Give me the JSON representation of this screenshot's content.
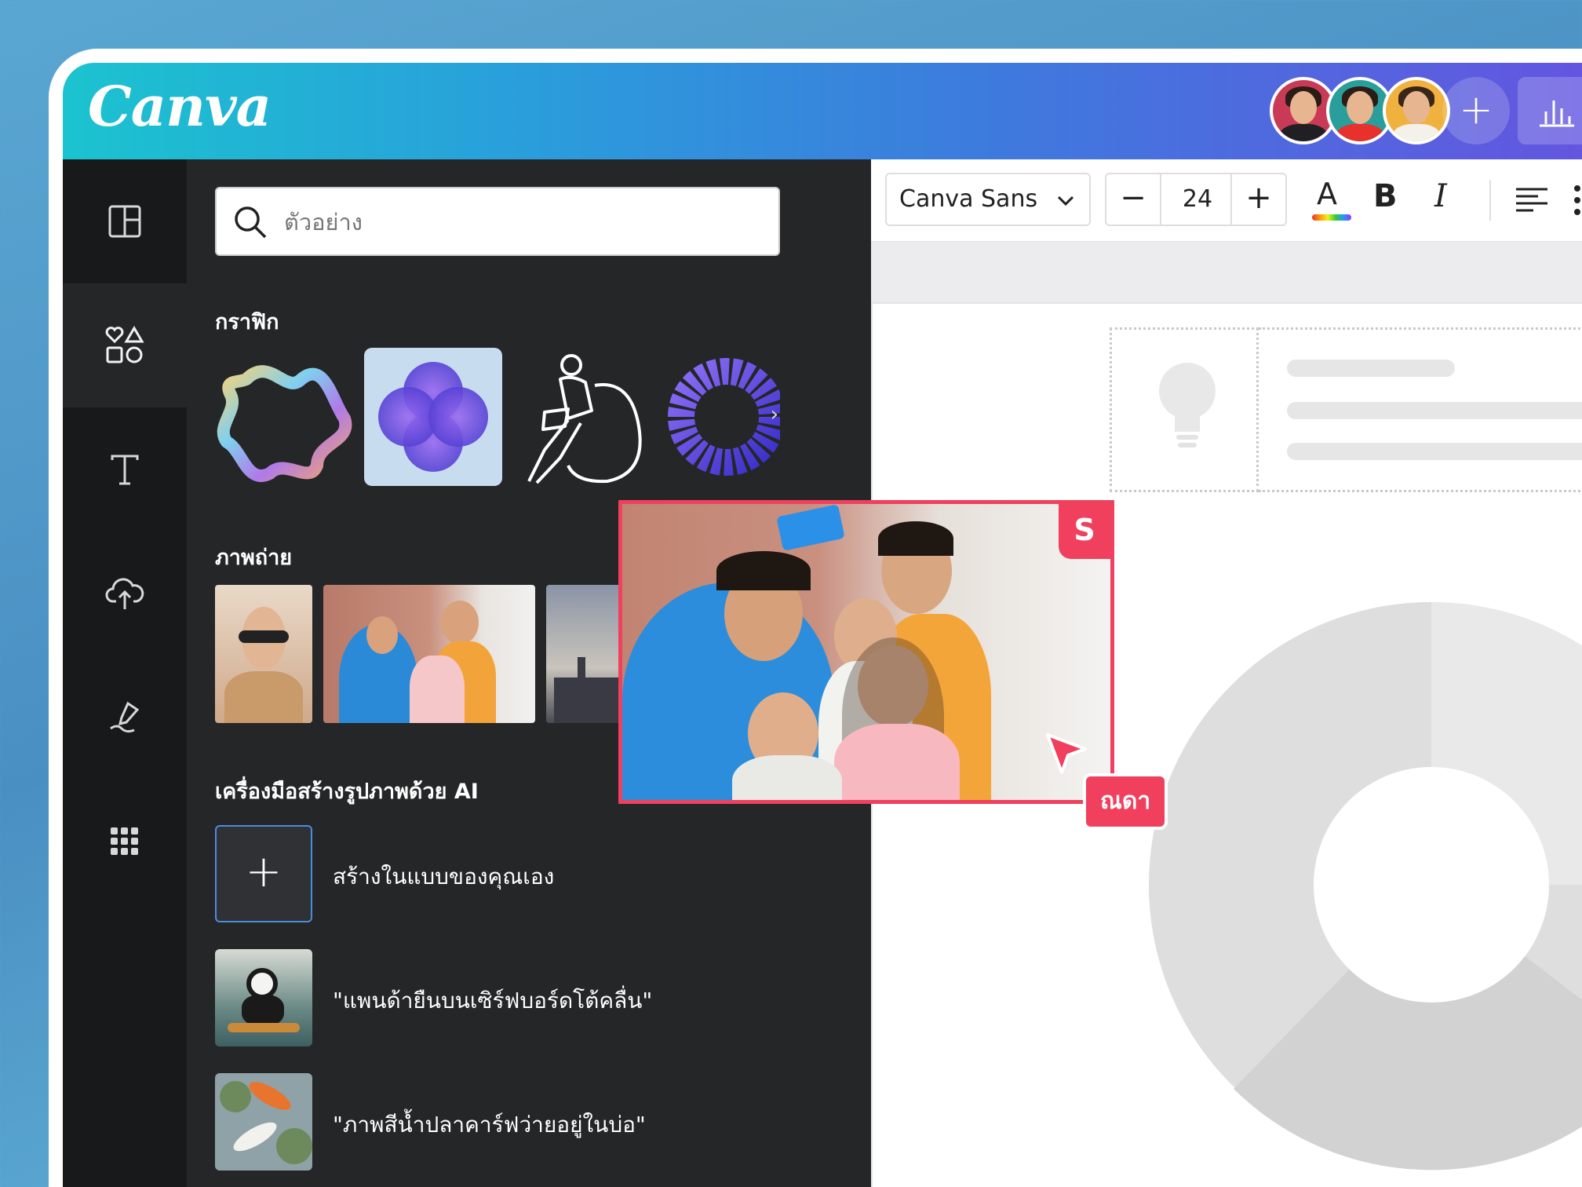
{
  "header": {
    "logo": "Canva",
    "collaborators": [
      "collaborator-1",
      "collaborator-2",
      "collaborator-3"
    ],
    "add_icon": "plus-icon",
    "insights_icon": "bar-chart-icon"
  },
  "sidebar": {
    "items": [
      {
        "name": "design",
        "icon": "layout-icon"
      },
      {
        "name": "elements",
        "icon": "shapes-icon"
      },
      {
        "name": "text",
        "icon": "text-icon"
      },
      {
        "name": "uploads",
        "icon": "cloud-upload-icon"
      },
      {
        "name": "draw",
        "icon": "pen-icon"
      },
      {
        "name": "apps",
        "icon": "apps-grid-icon"
      }
    ]
  },
  "panel": {
    "search": {
      "placeholder": "ตัวอย่าง"
    },
    "graphics": {
      "title": "กราฟิก"
    },
    "photos": {
      "title": "ภาพถ่าย"
    },
    "ai": {
      "title": "เครื่องมือสร้างรูปภาพด้วย AI",
      "items": [
        {
          "label": "สร้างในแบบของคุณเอง"
        },
        {
          "label": "\"แพนด้ายืนบนเซิร์ฟบอร์ดโต้คลื่น\""
        },
        {
          "label": "\"ภาพสีน้ำปลาคาร์ฟว่ายอยู่ในบ่อ\""
        }
      ]
    }
  },
  "toolbar": {
    "font": "Canva Sans",
    "font_size": "24",
    "bold": "B",
    "italic": "I",
    "text_color": "A"
  },
  "overlay": {
    "badge": "S",
    "user_tag": "ณดา"
  },
  "colors": {
    "accent": "#f0405e",
    "panel_bg": "#252627",
    "rail_bg": "#18191b"
  }
}
